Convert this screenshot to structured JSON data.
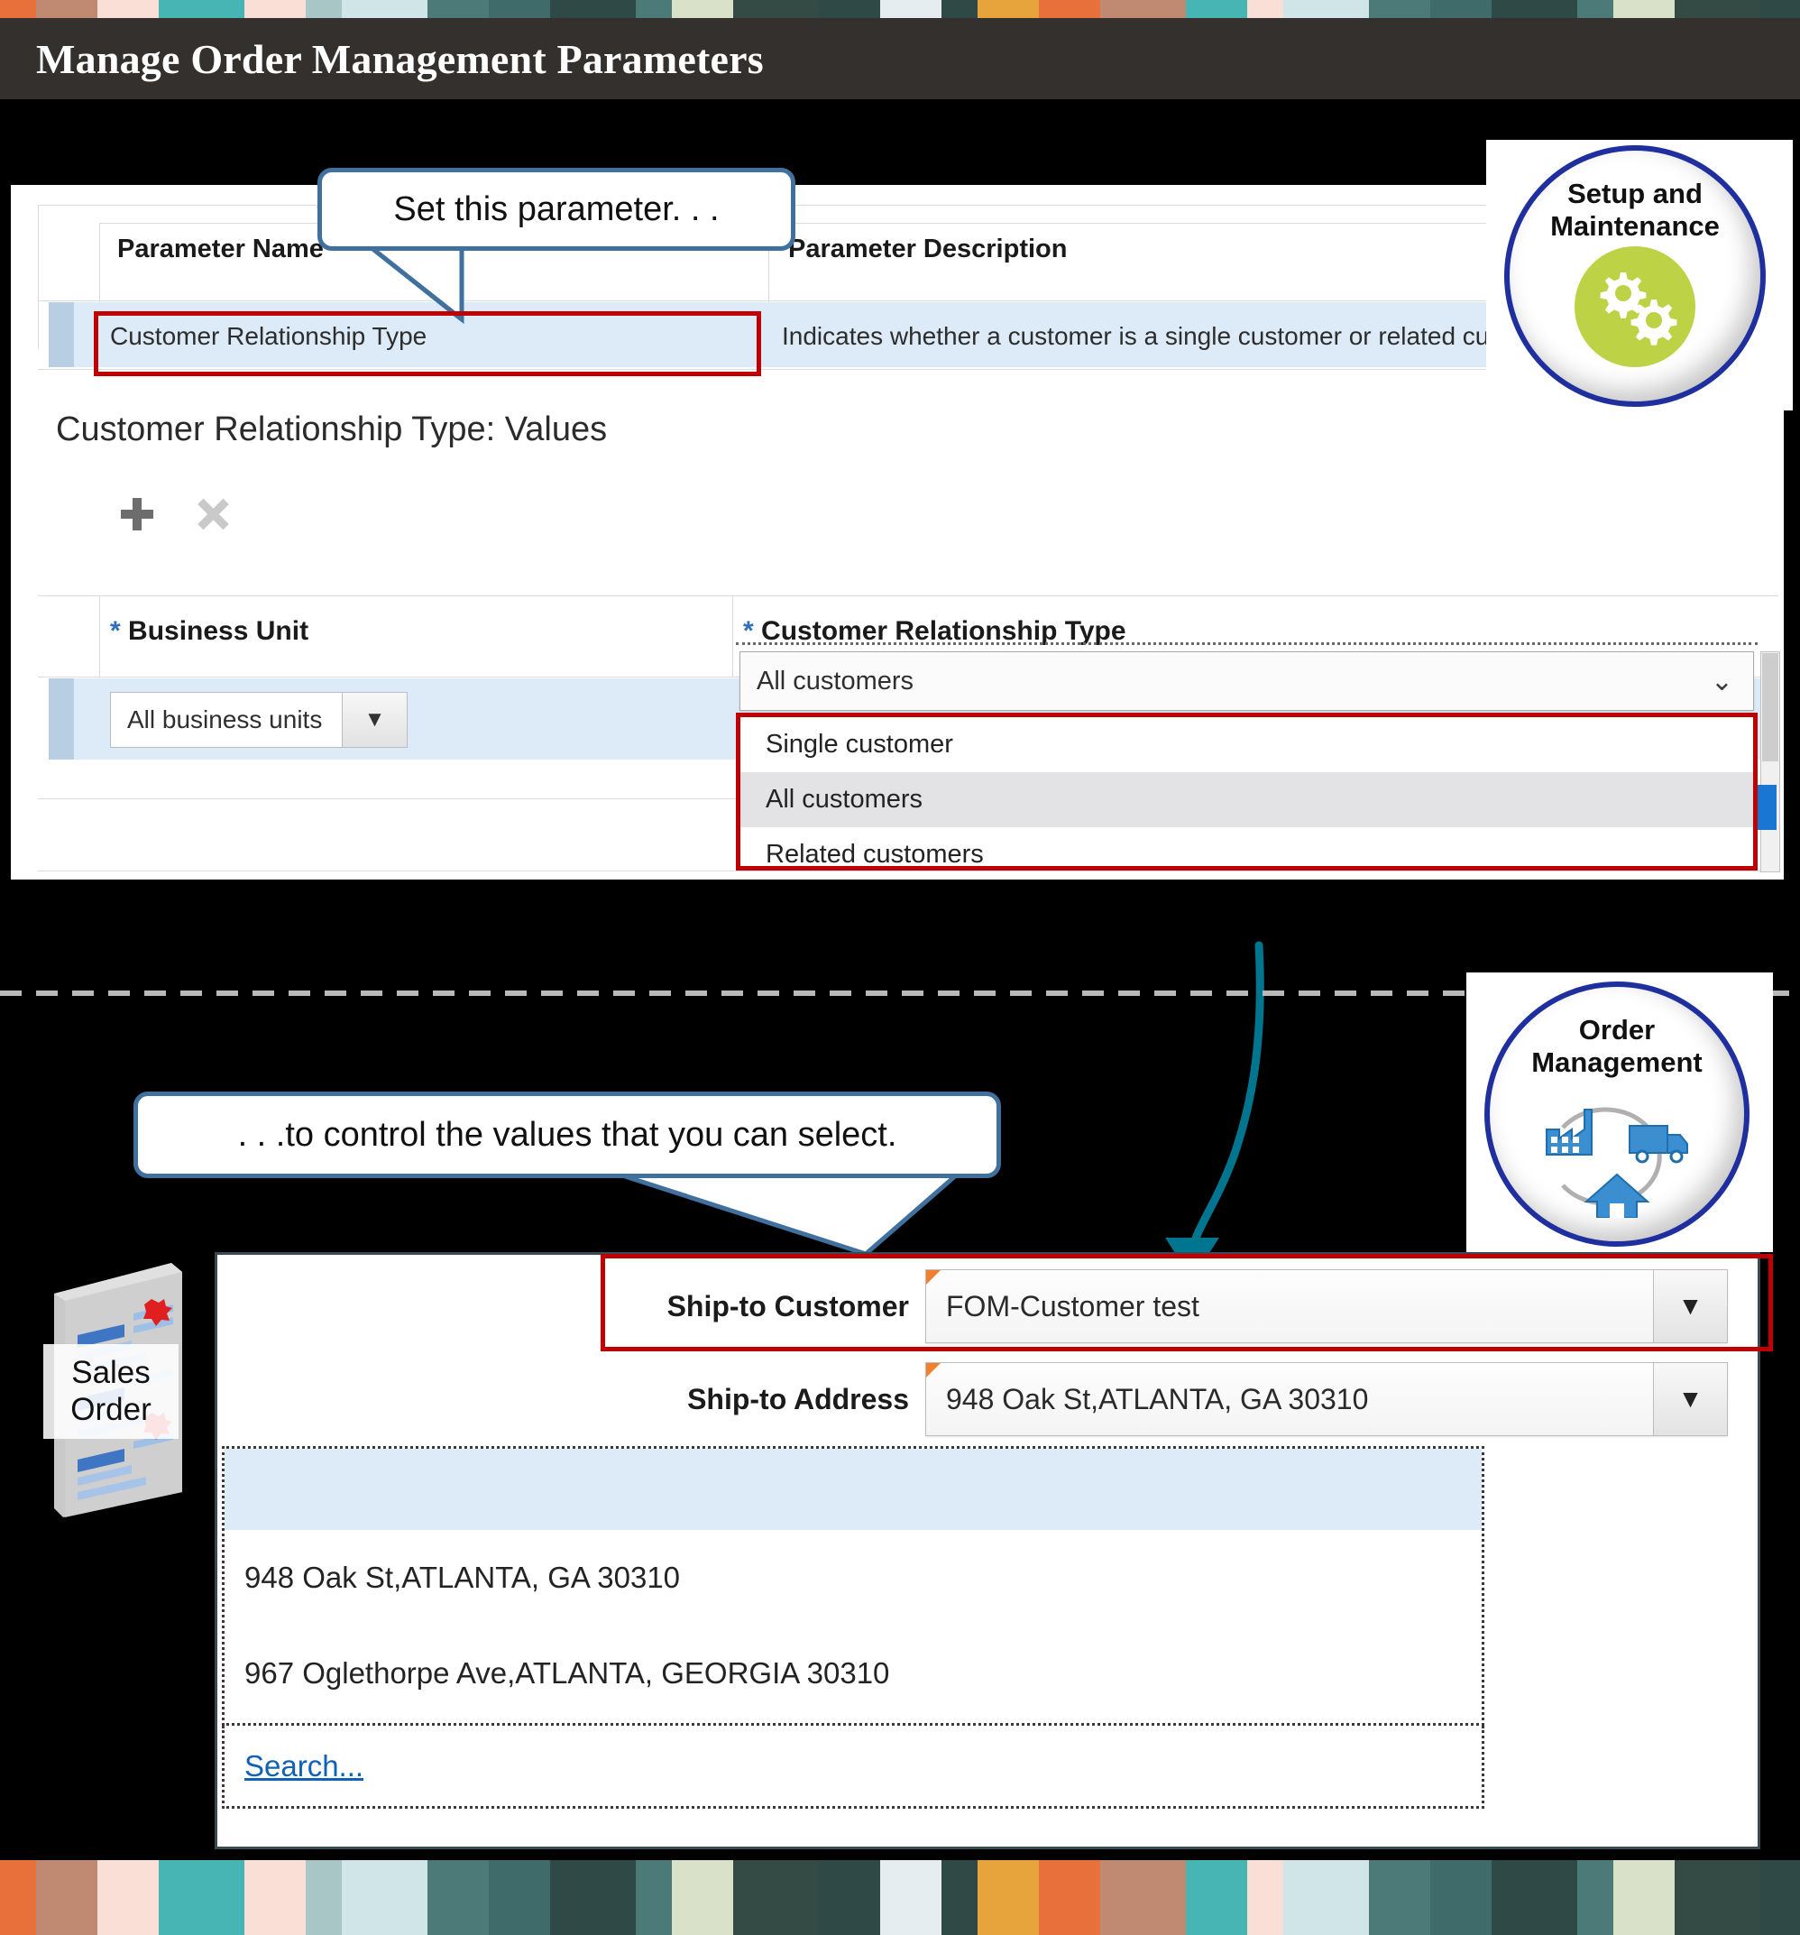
{
  "page": {
    "title": "Manage Order Management Parameters"
  },
  "setup_panel": {
    "table": {
      "columns": [
        "Parameter Name",
        "Parameter Description"
      ],
      "rows": [
        {
          "name": "Customer Relationship Type",
          "description": "Indicates whether a customer is a single customer or related customer or all customer"
        }
      ]
    },
    "section_title": "Customer Relationship Type: Values",
    "toolbar": {
      "add_label": "+",
      "delete_label": "✕"
    },
    "form": {
      "columns": [
        "Business Unit",
        "Customer Relationship Type"
      ],
      "required_marker": "*",
      "business_unit_value": "All business units",
      "customer_relationship_value": "All customers",
      "dropdown_caret": "⌵",
      "dropdown_options": [
        "Single customer",
        "All customers",
        "Related customers"
      ],
      "dropdown_selected": "All customers"
    }
  },
  "callouts": {
    "top": "Set this parameter. . .",
    "bottom": ". . .to control the values that you can select."
  },
  "badges": {
    "setup": {
      "line1": "Setup and",
      "line2": "Maintenance",
      "icon": "gears-icon",
      "accent": "#bed246",
      "ring": "#1f2f9e"
    },
    "order": {
      "line1": "Order",
      "line2": "Management",
      "icon": "supply-chain-icon",
      "accent": "#3b8ed0",
      "ring": "#1f2f9e"
    }
  },
  "order_panel": {
    "doc_label_line1": "Sales",
    "doc_label_line2": "Order",
    "ship_to_customer": {
      "label": "Ship-to Customer",
      "value": "FOM-Customer test",
      "caret": "▼"
    },
    "ship_to_address": {
      "label": "Ship-to Address",
      "value": "948 Oak St,ATLANTA, GA 30310",
      "caret": "▼"
    },
    "address_options": [
      "",
      "948 Oak St,ATLANTA, GA 30310",
      "967 Oglethorpe Ave,ATLANTA, GEORGIA 30310"
    ],
    "search_link": "Search..."
  },
  "colors": {
    "highlight_red": "#c00000",
    "callout_blue": "#40709e",
    "arrow_teal": "#00758f",
    "title_bar": "#33302e",
    "row_blue": "#ddeaf7"
  }
}
